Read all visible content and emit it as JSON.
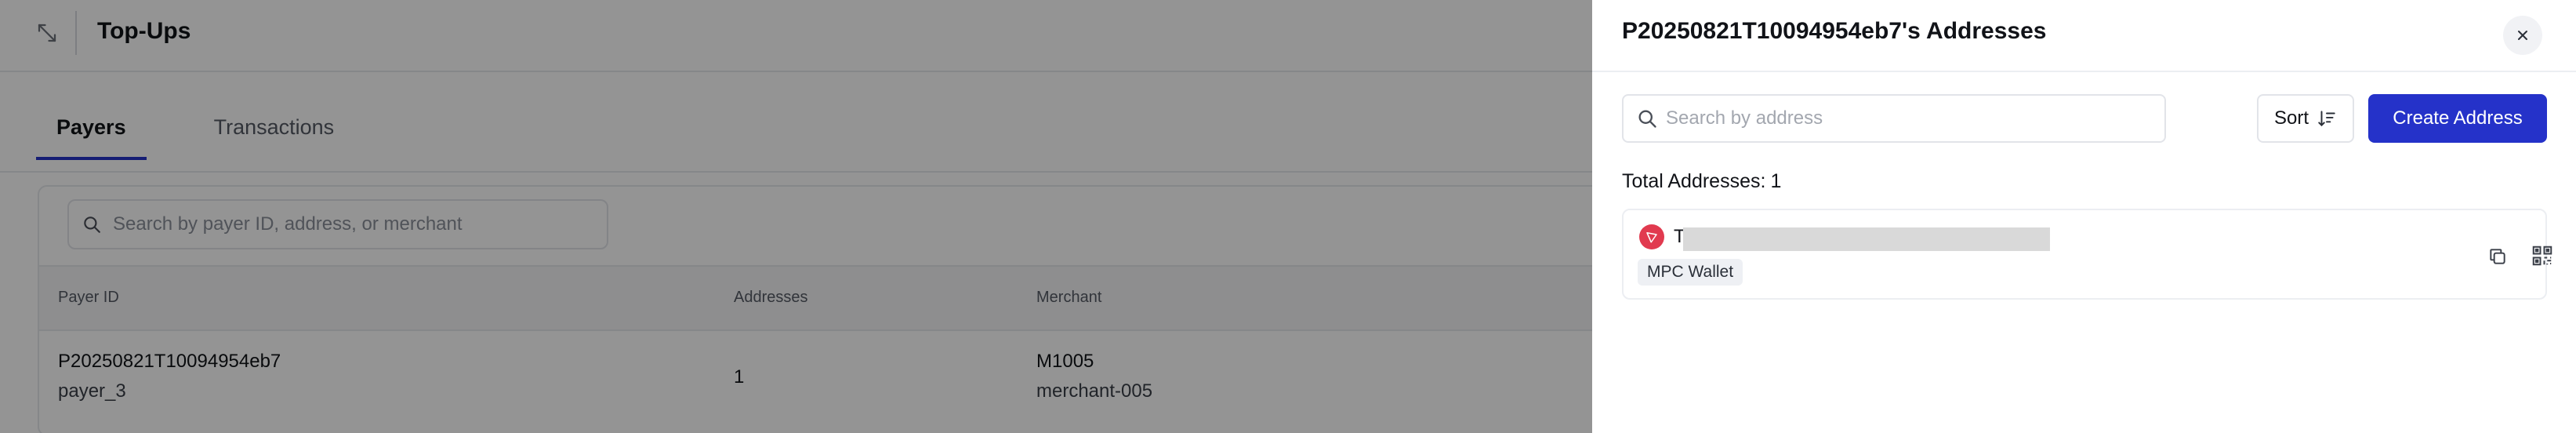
{
  "background_page": {
    "title": "Top-Ups",
    "tabs": [
      {
        "label": "Payers",
        "active": true
      },
      {
        "label": "Transactions",
        "active": false
      }
    ],
    "search": {
      "placeholder": "Search by payer ID, address, or merchant"
    },
    "table": {
      "columns": [
        "Payer ID",
        "Addresses",
        "Merchant"
      ],
      "rows": [
        {
          "payer_id": "P20250821T10094954eb7",
          "payer_name": "payer_3",
          "addresses": "1",
          "merchant_id": "M1005",
          "merchant_name": "merchant-005"
        }
      ]
    }
  },
  "drawer": {
    "title": "P20250821T10094954eb7's Addresses",
    "search": {
      "placeholder": "Search by address",
      "value": ""
    },
    "sort_label": "Sort",
    "create_label": "Create Address",
    "total_label": "Total Addresses:",
    "total_count": "1",
    "addresses": [
      {
        "address_prefix": "T",
        "network_icon": "tron-icon",
        "wallet_type": "MPC Wallet"
      }
    ]
  },
  "colors": {
    "accent": "#2532c9",
    "network_badge": "#e13a4f",
    "overlay": "rgba(0,0,0,0.42)"
  },
  "icons": [
    "expand-icon",
    "search-icon",
    "close-icon",
    "sort-icon",
    "tron-icon",
    "copy-icon",
    "qr-code-icon"
  ]
}
